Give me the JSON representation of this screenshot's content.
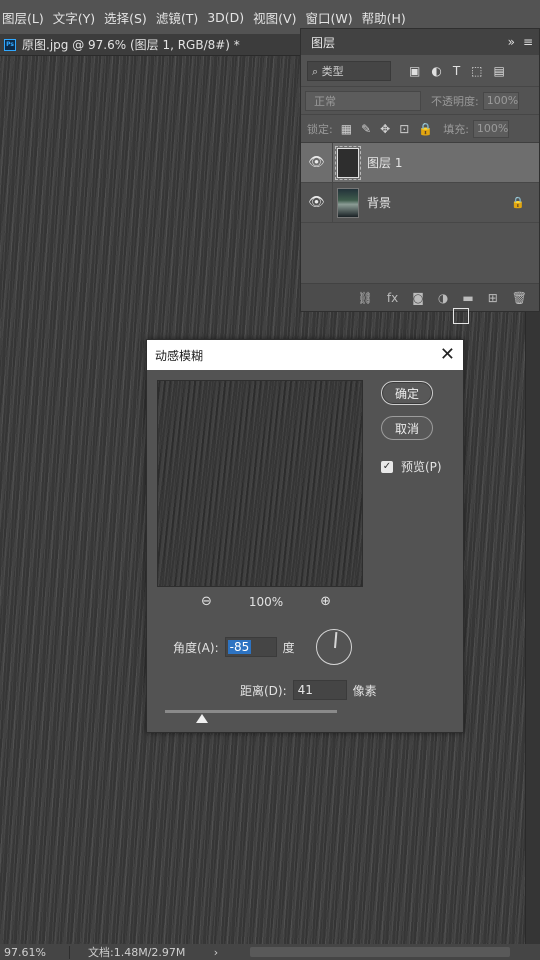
{
  "menu": [
    "图层(L)",
    "文字(Y)",
    "选择(S)",
    "滤镜(T)",
    "3D(D)",
    "视图(V)",
    "窗口(W)",
    "帮助(H)"
  ],
  "document": {
    "app_badge": "Ps",
    "tab_title": "原图.jpg @ 97.6% (图层 1, RGB/8#) *"
  },
  "layers_panel": {
    "title": "图层",
    "collapse_glyph": "»",
    "menu_glyph": "≡",
    "filter_placeholder": "⌕ 类型",
    "blend_mode": "正常",
    "opacity_label": "不透明度:",
    "opacity_value": "100%",
    "lock_label": "锁定:",
    "fill_label": "填充:",
    "fill_value": "100%",
    "layers": [
      {
        "name": "图层 1",
        "selected": true,
        "locked": false
      },
      {
        "name": "背景",
        "selected": false,
        "locked": true
      }
    ]
  },
  "dialog": {
    "title": "动感模糊",
    "close_glyph": "✕",
    "ok_label": "确定",
    "cancel_label": "取消",
    "preview_label": "预览(P)",
    "preview_checked": true,
    "zoom_level": "100%",
    "angle_label": "角度(A):",
    "angle_value": "-85",
    "angle_unit": "度",
    "distance_label": "距离(D):",
    "distance_value": "41",
    "distance_unit": "像素"
  },
  "status": {
    "zoom": "97.61%",
    "doc_info": "文档:1.48M/2.97M",
    "arrow": "›"
  },
  "icons": {
    "eye": "👁",
    "lock": "🔒",
    "zoom_out": "⊖",
    "zoom_in": "⊕"
  }
}
